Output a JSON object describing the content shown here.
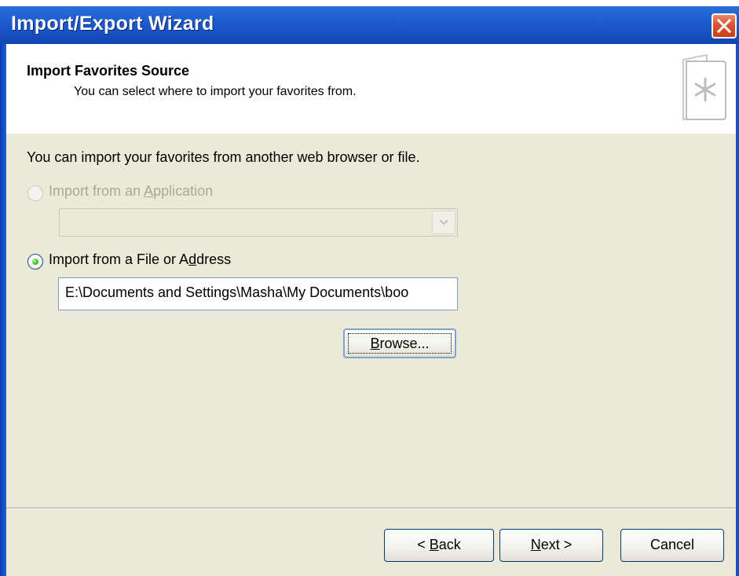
{
  "window": {
    "title": "Import/Export Wizard"
  },
  "header": {
    "title": "Import Favorites Source",
    "subtitle": "You can select where to import your favorites from.",
    "icon": "favorites-star-icon"
  },
  "body": {
    "intro": "You can import your favorites from another web browser or file.",
    "option_application": {
      "label_pre": "Import from an ",
      "label_accel": "A",
      "label_post": "pplication",
      "selected": false,
      "enabled": false
    },
    "application_select": {
      "value": "",
      "enabled": false
    },
    "option_file": {
      "label_pre": "Import from a File or A",
      "label_accel": "d",
      "label_post": "dress",
      "selected": true,
      "enabled": true
    },
    "file_path": {
      "value": "E:\\Documents and Settings\\Masha\\My Documents\\boo"
    },
    "browse": {
      "label_accel": "B",
      "label_post": "rowse..."
    }
  },
  "footer": {
    "back": {
      "label_pre": "< ",
      "label_accel": "B",
      "label_post": "ack"
    },
    "next": {
      "label_accel": "N",
      "label_post": "ext >"
    },
    "cancel": {
      "label": "Cancel"
    }
  },
  "colors": {
    "title_bar": "#1f5fd0",
    "dialog_bg": "#ece9d8",
    "header_bg": "#ffffff",
    "close_button": "#d9542f",
    "radio_selected_dot": "#46c32a",
    "disabled_text": "#aca899"
  }
}
